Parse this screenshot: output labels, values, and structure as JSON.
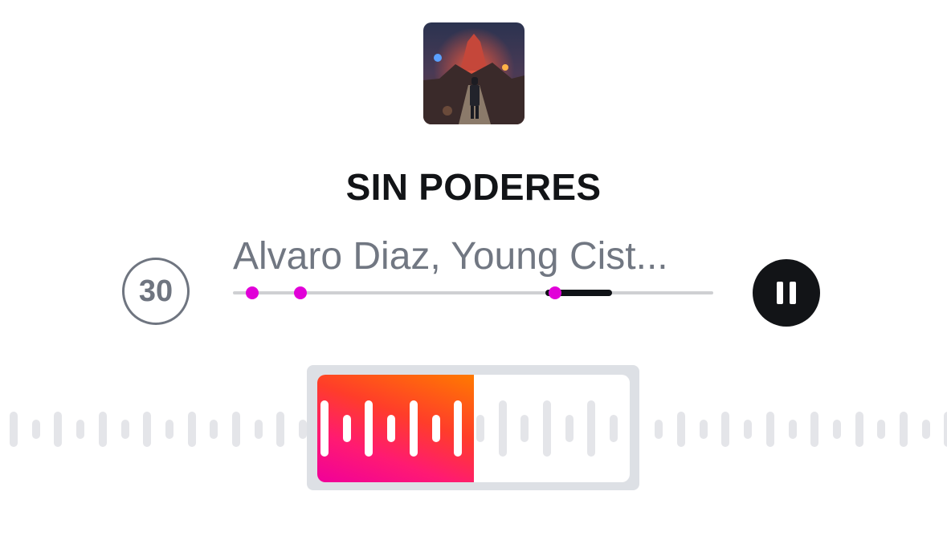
{
  "player": {
    "cover_name": "album-art",
    "title": "SIN PODERES",
    "artist": "Alvaro Diaz, Young Cist...",
    "skip_label": "30",
    "progress": {
      "segment_start": 0.65,
      "segment_end": 0.79,
      "markers": [
        0.04,
        0.14,
        0.67
      ]
    }
  },
  "colors": {
    "accent_pink": "#e100d8",
    "gradient_start": "#ff7a00",
    "gradient_end": "#f0009a",
    "dark": "#121417",
    "muted": "#717782"
  },
  "icons": {
    "skip": "skip-30-icon",
    "pause": "pause-icon"
  },
  "selection": {
    "fill_fraction": 0.5,
    "bar_heights": [
      0.52,
      0.26,
      0.52,
      0.26,
      0.52,
      0.26,
      0.52,
      0.26,
      0.52,
      0.26,
      0.52,
      0.26,
      0.52,
      0.26
    ]
  },
  "waveform": {
    "pattern": [
      0.45,
      0.25
    ]
  }
}
